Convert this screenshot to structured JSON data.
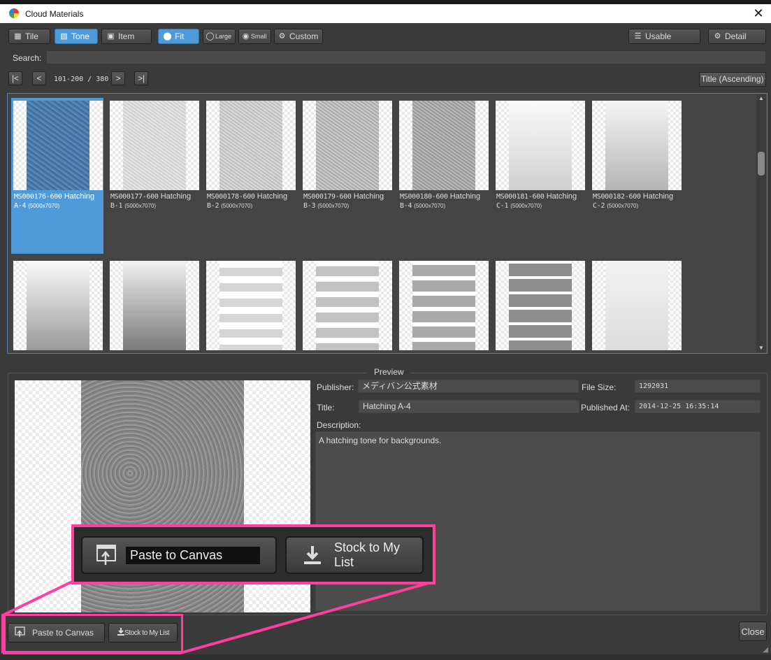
{
  "window": {
    "title": "Cloud Materials"
  },
  "toolbar": {
    "view_buttons": [
      {
        "id": "tile",
        "label": "Tile",
        "icon": "checker-icon"
      },
      {
        "id": "tone",
        "label": "Tone",
        "icon": "tone-icon",
        "active": true
      },
      {
        "id": "item",
        "label": "Item",
        "icon": "image-icon"
      }
    ],
    "size_buttons": [
      {
        "id": "fit",
        "label": "Fit",
        "active": true
      },
      {
        "id": "large",
        "label": "Large"
      },
      {
        "id": "small",
        "label": "Small"
      },
      {
        "id": "custom",
        "label": "Custom"
      }
    ],
    "usable_label": "Usable",
    "detail_label": "Detail"
  },
  "search": {
    "label": "Search:",
    "value": ""
  },
  "pagination": {
    "range": "101-200 / 380",
    "sort": "Title (Ascending)"
  },
  "materials": [
    {
      "code": "MS000176-600",
      "name": "Hatching",
      "subcode": "A-4",
      "size": "(5000x7070)",
      "selected": true
    },
    {
      "code": "MS000177-600",
      "name": "Hatching",
      "subcode": "B-1",
      "size": "(5000x7070)"
    },
    {
      "code": "MS000178-600",
      "name": "Hatching",
      "subcode": "B-2",
      "size": "(5000x7070)"
    },
    {
      "code": "MS000179-600",
      "name": "Hatching",
      "subcode": "B-3",
      "size": "(5000x7070)"
    },
    {
      "code": "MS000180-600",
      "name": "Hatching",
      "subcode": "B-4",
      "size": "(5000x7070)"
    },
    {
      "code": "MS000181-600",
      "name": "Hatching",
      "subcode": "C-1",
      "size": "(5000x7070)"
    },
    {
      "code": "MS000182-600",
      "name": "Hatching",
      "subcode": "C-2",
      "size": "(5000x7070)"
    }
  ],
  "preview": {
    "label": "Preview",
    "publisher_label": "Publisher:",
    "publisher": "メディバン公式素材",
    "filesize_label": "File Size:",
    "filesize": "1292031",
    "title_label": "Title:",
    "title": "Hatching A-4",
    "published_label": "Published At:",
    "published": "2014-12-25 16:35:14",
    "description_label": "Description:",
    "description": "A hatching tone for backgrounds."
  },
  "actions": {
    "paste_label": "Paste to Canvas",
    "stock_label": "Stock to My List",
    "close_label": "Close"
  },
  "colors": {
    "accent": "#4f9ad8",
    "highlight": "#ff3fa0"
  }
}
